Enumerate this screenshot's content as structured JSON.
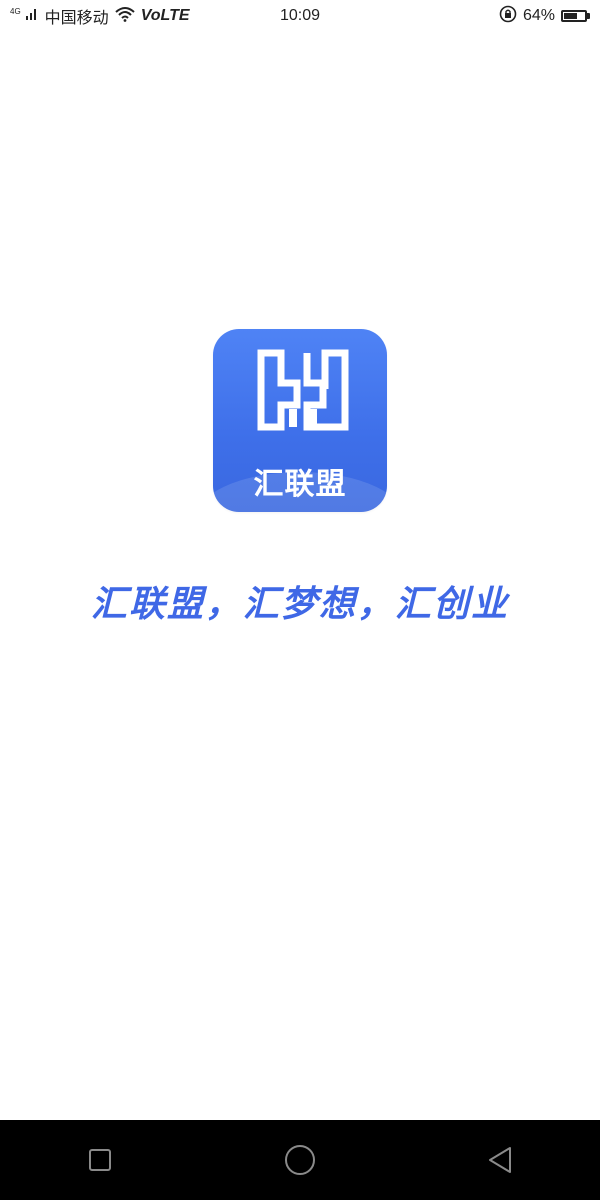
{
  "status_bar": {
    "network_badge": "4G",
    "carrier": "中国移动",
    "volte": "VoLTE",
    "time": "10:09",
    "battery_percent_text": "64%",
    "battery_level": 0.64
  },
  "app_icon": {
    "logo_text": "汇联盟"
  },
  "slogan": "汇联盟，汇梦想，汇创业",
  "colors": {
    "brand_blue": "#4a7bf2",
    "slogan_blue": "#3f68e6",
    "nav_bar": "#000000"
  }
}
